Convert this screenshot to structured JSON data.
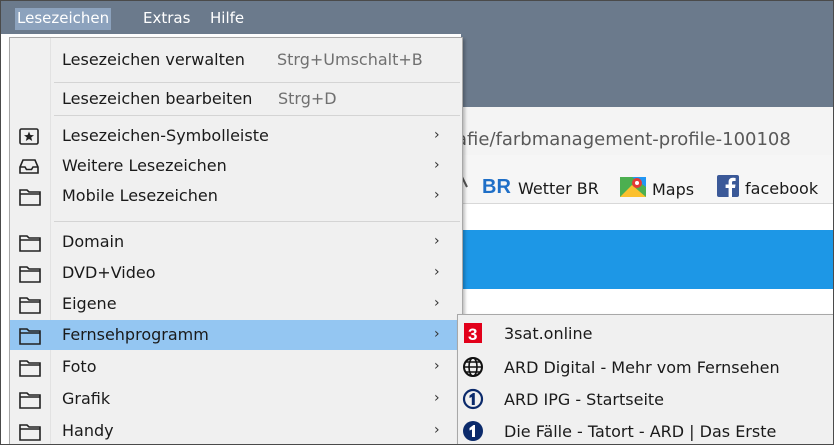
{
  "menubar": {
    "items": [
      {
        "label": "Lesezeichen",
        "active": true
      },
      {
        "label": "Extras",
        "active": false
      },
      {
        "label": "Hilfe",
        "active": false
      }
    ]
  },
  "background": {
    "url_fragment": "afie/farbmanagement-profile-100108",
    "bookmarks": [
      {
        "label": "Wetter BR",
        "icon": "br-logo-icon"
      },
      {
        "label": "Maps",
        "icon": "google-maps-icon"
      },
      {
        "label": "facebook",
        "icon": "facebook-icon"
      }
    ],
    "accent_blue": "#1d97e6"
  },
  "menu": {
    "items": [
      {
        "label": "Lesezeichen verwalten",
        "shortcut": "Strg+Umschalt+B"
      },
      {
        "label": "Lesezeichen bearbeiten",
        "shortcut": "Strg+D"
      },
      {
        "label": "Lesezeichen-Symbolleiste",
        "icon": "bookmark-toolbar-icon",
        "submenu": true
      },
      {
        "label": "Weitere Lesezeichen",
        "icon": "inbox-tray-icon",
        "submenu": true
      },
      {
        "label": "Mobile Lesezeichen",
        "icon": "folder-icon",
        "submenu": true
      },
      {
        "label": "Domain",
        "icon": "folder-icon",
        "submenu": true
      },
      {
        "label": "DVD+Video",
        "icon": "folder-icon",
        "submenu": true
      },
      {
        "label": "Eigene",
        "icon": "folder-icon",
        "submenu": true
      },
      {
        "label": "Fernsehprogramm",
        "icon": "folder-icon",
        "submenu": true,
        "highlighted": true
      },
      {
        "label": "Foto",
        "icon": "folder-icon",
        "submenu": true
      },
      {
        "label": "Grafik",
        "icon": "folder-icon",
        "submenu": true
      },
      {
        "label": "Handy",
        "icon": "folder-icon",
        "submenu": true
      }
    ],
    "arrow": "›",
    "highlight_color": "#94c6f2"
  },
  "submenu": {
    "items": [
      {
        "label": "3sat.online",
        "icon": "3sat-logo-icon"
      },
      {
        "label": "ARD Digital - Mehr vom Fernsehen",
        "icon": "globe-icon"
      },
      {
        "label": "ARD IPG - Startseite",
        "icon": "ard-one-logo-icon"
      },
      {
        "label": "Die Fälle - Tatort - ARD | Das Erste",
        "icon": "das-erste-logo-icon"
      }
    ]
  }
}
